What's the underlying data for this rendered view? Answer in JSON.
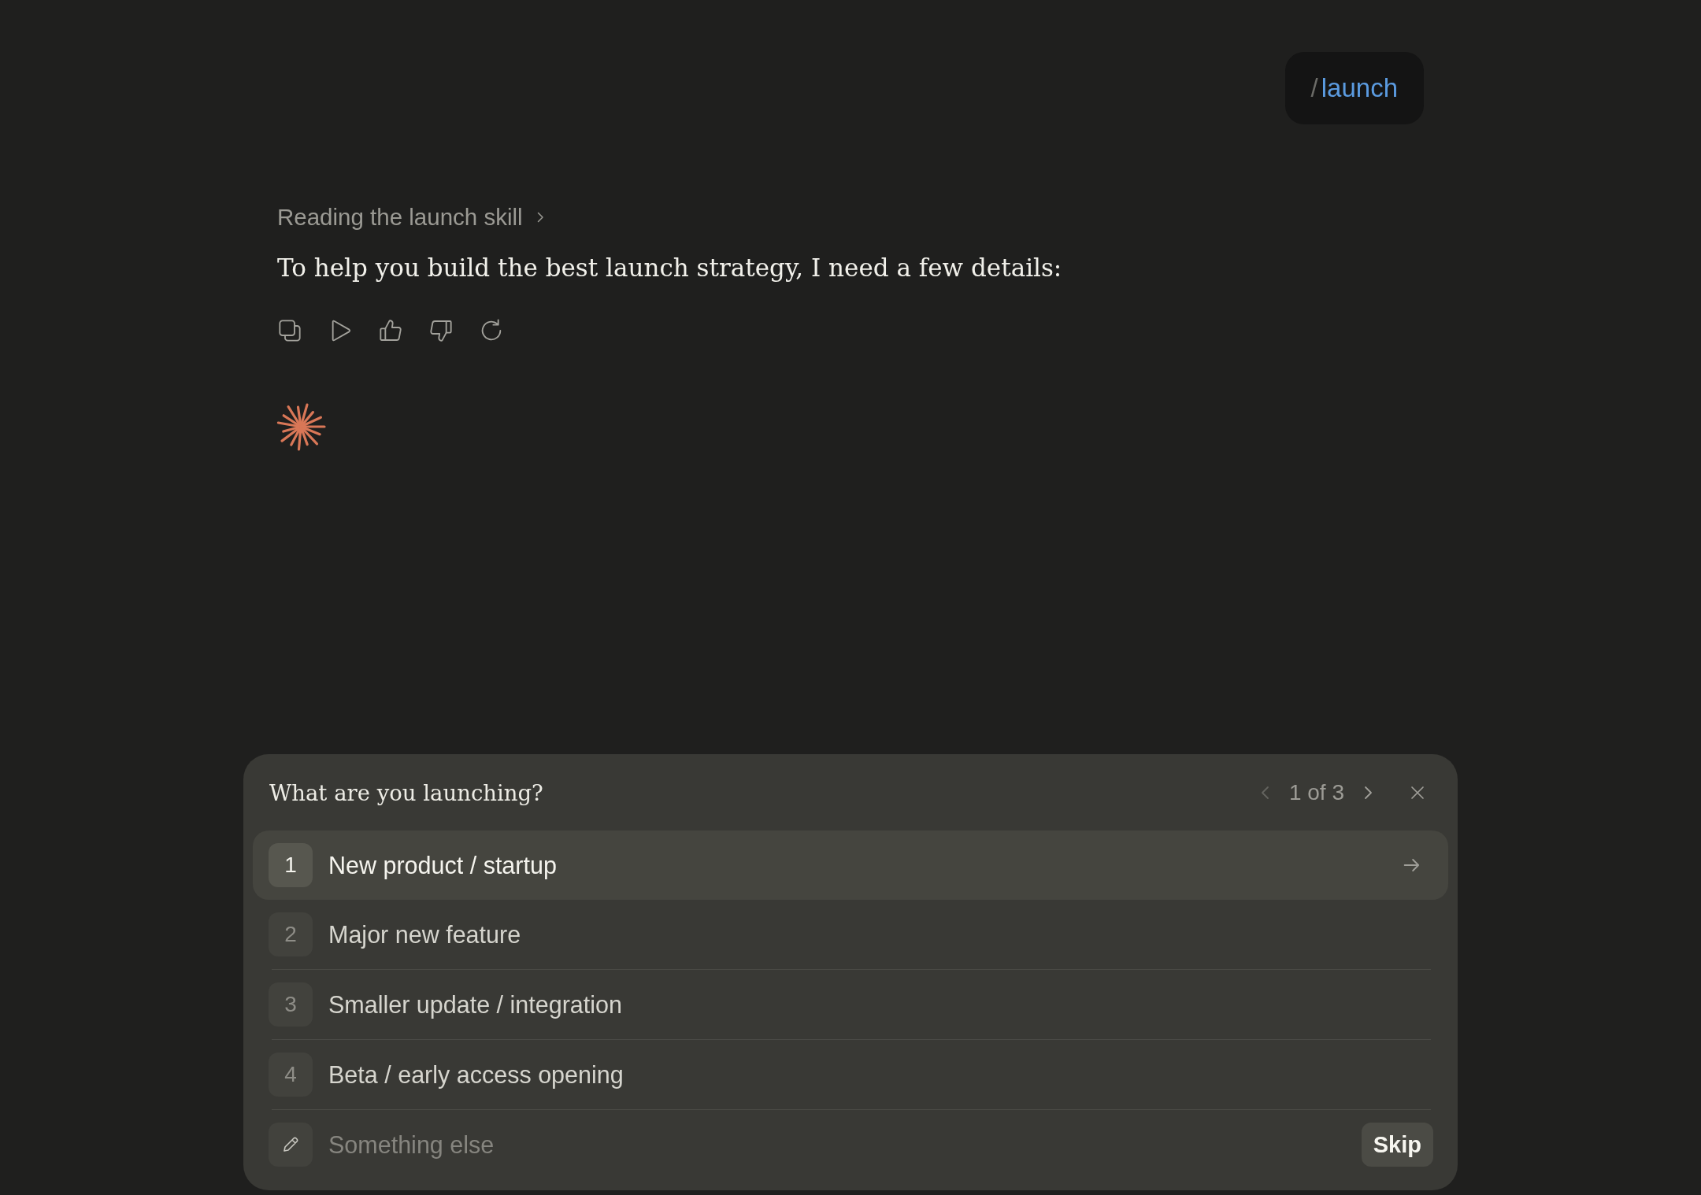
{
  "user_message": {
    "prefix": "/",
    "command": "launch"
  },
  "assistant": {
    "status": "Reading the launch skill",
    "text": "To help you build the best launch strategy, I need a few details:"
  },
  "question_panel": {
    "title": "What are you launching?",
    "pager": {
      "text": "1 of 3",
      "prev_disabled": true,
      "next_disabled": false
    },
    "options": [
      {
        "number": "1",
        "label": "New product / startup",
        "selected": true
      },
      {
        "number": "2",
        "label": "Major new feature",
        "selected": false
      },
      {
        "number": "3",
        "label": "Smaller update / integration",
        "selected": false
      },
      {
        "number": "4",
        "label": "Beta / early access opening",
        "selected": false
      }
    ],
    "other": {
      "placeholder": "Something else"
    },
    "skip_button": "Skip"
  }
}
